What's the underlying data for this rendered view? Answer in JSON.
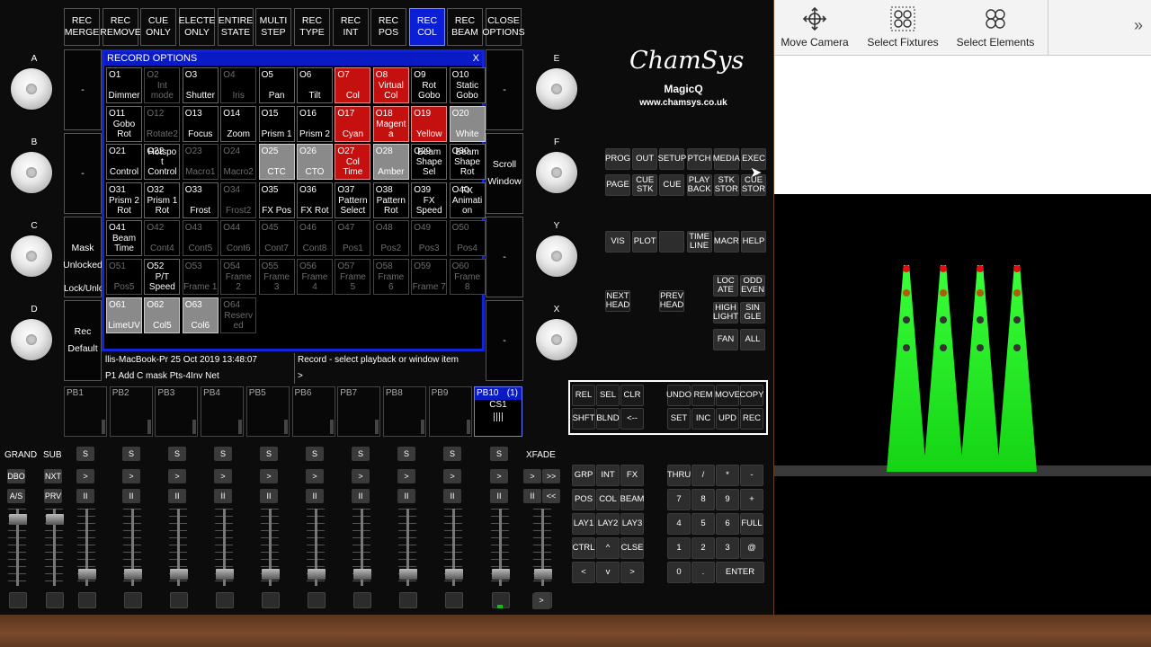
{
  "top_softkeys": [
    {
      "label": "REC\nMERGE"
    },
    {
      "label": "REC\nREMOVE"
    },
    {
      "label": "CUE\nONLY"
    },
    {
      "label": "ELECTE\nONLY"
    },
    {
      "label": "ENTIRE\nSTATE"
    },
    {
      "label": "MULTI\nSTEP"
    },
    {
      "label": "REC\nTYPE"
    },
    {
      "label": "REC\nINT"
    },
    {
      "label": "REC\nPOS"
    },
    {
      "label": "REC\nCOL",
      "selected": true
    },
    {
      "label": "REC\nBEAM"
    },
    {
      "label": "CLOSE\nOPTIONS"
    }
  ],
  "left_softkeys": [
    "-",
    "-",
    "Mask\nUnlocked",
    "Rec\nDefault"
  ],
  "left_lock_text": "Lock/Unlock",
  "right_softkeys": [
    "-",
    "Scroll\nWindow",
    "-",
    "-"
  ],
  "encoders_left": [
    "A",
    "B",
    "C",
    "D"
  ],
  "encoders_right": [
    "E",
    "F",
    "Y",
    "X"
  ],
  "window": {
    "title": "RECORD OPTIONS",
    "close": "X",
    "cells": [
      [
        "O1",
        "Dimmer",
        ""
      ],
      [
        "O2",
        "Int\nmode",
        "dis"
      ],
      [
        "O3",
        "Shutter",
        ""
      ],
      [
        "O4",
        "Iris",
        "dis"
      ],
      [
        "O5",
        "Pan",
        ""
      ],
      [
        "O6",
        "Tilt",
        ""
      ],
      [
        "O7",
        "Col",
        "red"
      ],
      [
        "O8",
        "Virtual\nCol",
        "red"
      ],
      [
        "O9",
        "Rot\nGobo",
        ""
      ],
      [
        "O10",
        "Static\nGobo",
        ""
      ],
      [
        "O11",
        "Gobo\nRot",
        ""
      ],
      [
        "O12",
        "Rotate2",
        "dis"
      ],
      [
        "O13",
        "Focus",
        ""
      ],
      [
        "O14",
        "Zoom",
        ""
      ],
      [
        "O15",
        "Prism 1",
        ""
      ],
      [
        "O16",
        "Prism 2",
        ""
      ],
      [
        "O17",
        "Cyan",
        "red"
      ],
      [
        "O18",
        "Magent\na",
        "red"
      ],
      [
        "O19",
        "Yellow",
        "red"
      ],
      [
        "O20",
        "White",
        "grey"
      ],
      [
        "O21",
        "Control",
        ""
      ],
      [
        "O22",
        "Hotspo\nt\nControl",
        ""
      ],
      [
        "O23",
        "Macro1",
        "dis"
      ],
      [
        "O24",
        "Macro2",
        "dis"
      ],
      [
        "O25",
        "CTC",
        "grey"
      ],
      [
        "O26",
        "CTO",
        "grey"
      ],
      [
        "O27",
        "Col\nTime",
        "red"
      ],
      [
        "O28",
        "Amber",
        "grey"
      ],
      [
        "O29",
        "Beam\nShape\nSel",
        ""
      ],
      [
        "O30",
        "Beam\nShape\nRot",
        ""
      ],
      [
        "O31",
        "Prism 2\nRot",
        ""
      ],
      [
        "O32",
        "Prism 1\nRot",
        ""
      ],
      [
        "O33",
        "Frost",
        ""
      ],
      [
        "O34",
        "Frost2",
        "dis"
      ],
      [
        "O35",
        "FX Pos",
        ""
      ],
      [
        "O36",
        "FX Rot",
        ""
      ],
      [
        "O37",
        "Pattern\nSelect",
        ""
      ],
      [
        "O38",
        "Pattern\nRot",
        ""
      ],
      [
        "O39",
        "FX\nSpeed",
        ""
      ],
      [
        "O40",
        "FX\nAnimati\non",
        ""
      ],
      [
        "O41",
        "Beam\nTime",
        ""
      ],
      [
        "O42",
        "Cont4",
        "dis"
      ],
      [
        "O43",
        "Cont5",
        "dis"
      ],
      [
        "O44",
        "Cont6",
        "dis"
      ],
      [
        "O45",
        "Cont7",
        "dis"
      ],
      [
        "O46",
        "Cont8",
        "dis"
      ],
      [
        "O47",
        "Pos1",
        "dis"
      ],
      [
        "O48",
        "Pos2",
        "dis"
      ],
      [
        "O49",
        "Pos3",
        "dis"
      ],
      [
        "O50",
        "Pos4",
        "dis"
      ],
      [
        "O51",
        "Pos5",
        "dis"
      ],
      [
        "O52",
        "P/T\nSpeed",
        ""
      ],
      [
        "O53",
        "Frame 1",
        "dis"
      ],
      [
        "O54",
        "Frame\n2",
        "dis"
      ],
      [
        "O55",
        "Frame\n3",
        "dis"
      ],
      [
        "O56",
        "Frame\n4",
        "dis"
      ],
      [
        "O57",
        "Frame\n5",
        "dis"
      ],
      [
        "O58",
        "Frame\n6",
        "dis"
      ],
      [
        "O59",
        "Frame 7",
        "dis"
      ],
      [
        "O60",
        "Frame\n8",
        "dis"
      ],
      [
        "O61",
        "LimeUV",
        "grey"
      ],
      [
        "O62",
        "Col5",
        "grey"
      ],
      [
        "O63",
        "Col6",
        "grey"
      ],
      [
        "O64",
        "Reserv\ned",
        "dis"
      ]
    ]
  },
  "status": {
    "host": "llis-MacBook-Pr 25 Oct 2019 13:48:07",
    "prompt": "Record - select playback or window item",
    "cmd": "P1  Add C mask Pts-4Inv Net",
    "input": ">"
  },
  "playbacks": [
    "PB1",
    "PB2",
    "PB3",
    "PB4",
    "PB5",
    "PB6",
    "PB7",
    "PB8",
    "PB9"
  ],
  "pb10": {
    "label": "PB10",
    "count": "(1)",
    "cue": "CS1"
  },
  "faders": {
    "grand": "GRAND",
    "sub": "SUB",
    "xfade": "XFADE",
    "dbo": "DBO",
    "nxt": "NXT",
    "as": "A/S",
    "prv": "PRV",
    "s": "S",
    "go": ">",
    "pause": "II",
    "back": "<<",
    "fwd": ">>"
  },
  "logo": {
    "brand": "ChamSys",
    "product": "MagicQ",
    "url": "www.chamsys.co.uk"
  },
  "keys_top": [
    [
      "PROG",
      "OUT",
      "SETUP",
      "PTCH",
      "MEDIA",
      "EXEC"
    ],
    [
      "PAGE",
      "CUE\nSTK",
      "CUE",
      "PLAY\nBACK",
      "STK\nSTOR",
      "CUE\nSTOR"
    ]
  ],
  "keys_mid": [
    "VIS",
    "PLOT",
    "",
    "TIME\nLINE",
    "MACR",
    "HELP"
  ],
  "keys_head": [
    "NEXT\nHEAD",
    "PREV\nHEAD"
  ],
  "keys_sel": [
    [
      "LOC\nATE",
      "ODD\nEVEN"
    ],
    [
      "HIGH\nLIGHT",
      "SIN\nGLE"
    ],
    [
      "FAN",
      "ALL"
    ]
  ],
  "keys_box": [
    [
      "REL",
      "SEL",
      "CLR",
      "UNDO",
      "REM",
      "MOVE",
      "COPY"
    ],
    [
      "SHFT",
      "BLND",
      "<--",
      "SET",
      "INC",
      "UPD",
      "REC"
    ]
  ],
  "keys_bottom_left": [
    [
      "GRP",
      "INT",
      "FX"
    ],
    [
      "POS",
      "COL",
      "BEAM"
    ],
    [
      "LAY1",
      "LAY2",
      "LAY3"
    ],
    [
      "CTRL",
      "^",
      "CLSE"
    ],
    [
      "<",
      "v",
      ">"
    ]
  ],
  "keys_numpad": [
    [
      "THRU",
      "/",
      "*",
      "-"
    ],
    [
      "7",
      "8",
      "9",
      "+"
    ],
    [
      "4",
      "5",
      "6",
      "FULL"
    ],
    [
      "1",
      "2",
      "3",
      "@"
    ],
    [
      "0",
      ".",
      "ENTER"
    ]
  ],
  "toolbar": {
    "move": "Move Camera",
    "fixtures": "Select Fixtures",
    "elements": "Select Elements",
    "more": "»"
  }
}
